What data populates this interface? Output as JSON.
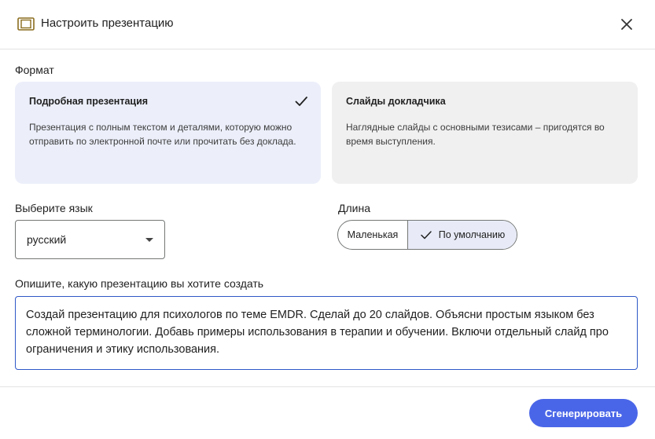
{
  "header": {
    "title": "Настроить презентацию",
    "icon": "presentation-icon"
  },
  "format": {
    "label": "Формат",
    "options": [
      {
        "title": "Подробная презентация",
        "description": "Презентация с полным текстом и деталями, которую можно отправить по электронной почте или прочитать без доклада.",
        "selected": true
      },
      {
        "title": "Слайды докладчика",
        "description": "Наглядные слайды с основными тезисами – пригодятся во время выступления.",
        "selected": false
      }
    ]
  },
  "language": {
    "label": "Выберите язык",
    "selected": "русский"
  },
  "length": {
    "label": "Длина",
    "options": [
      "Маленькая",
      "По умолчанию"
    ],
    "selected": "По умолчанию"
  },
  "prompt": {
    "label": "Опишите, какую презентацию вы хотите создать",
    "value": "Создай презентацию для психологов по теме EMDR. Сделай до 20 слайдов. Объясни простым языком без сложной терминологии. Добавь примеры использования в терапии и обучении. Включи отдельный слайд про ограничения и этику использования."
  },
  "actions": {
    "generate_label": "Сгенерировать"
  },
  "colors": {
    "accent": "#4a66e8",
    "selected_card": "#eceffa",
    "focus_border": "#2f58c7"
  }
}
